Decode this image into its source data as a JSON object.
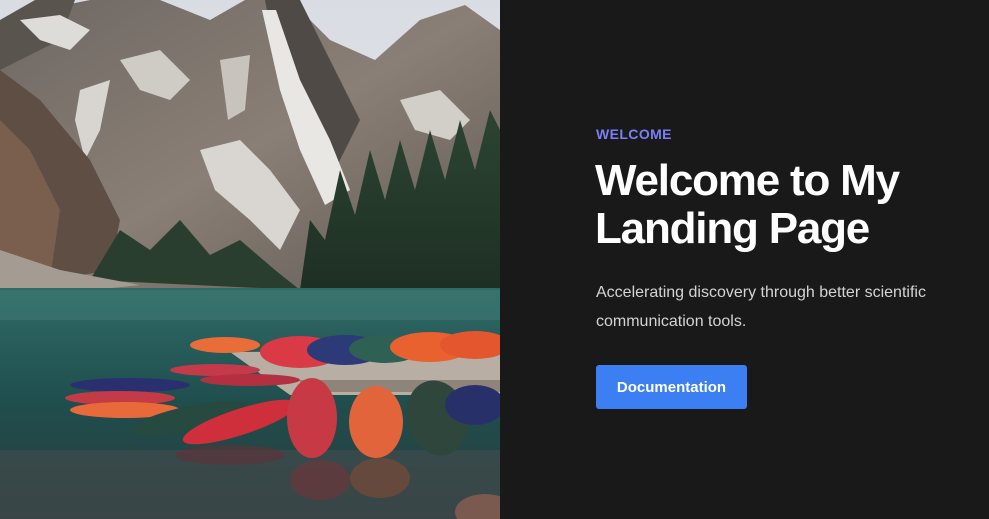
{
  "hero": {
    "image_label": "mountain lake with canoes"
  },
  "intro": {
    "eyebrow": "WELCOME",
    "title": "Welcome to My Landing Page",
    "description": "Accelerating discovery through better scientific communication tools.",
    "cta_label": "Documentation"
  },
  "colors": {
    "background": "#1a1919",
    "accent": "#7b7ff5",
    "button": "#3b7ff2",
    "text_primary": "#ffffff",
    "text_secondary": "#d4d4d4"
  }
}
